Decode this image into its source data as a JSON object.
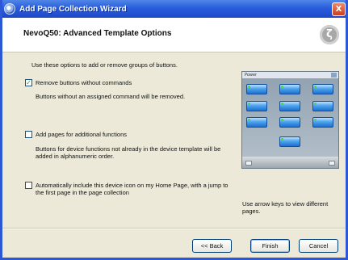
{
  "window": {
    "title": "Add Page Collection Wizard",
    "close_label": "X"
  },
  "header": {
    "heading": "NevoQ50: Advanced Template Options",
    "logo_glyph": "ζ"
  },
  "content": {
    "intro": "Use these options to add or remove groups of buttons.",
    "options": [
      {
        "label": "Remove buttons without commands",
        "checked": true,
        "description": "Buttons without an assigned command will be removed."
      },
      {
        "label": "Add pages for additional functions",
        "checked": false,
        "description": "Buttons for device functions not already in the device template will be added in alphanumeric order."
      },
      {
        "label": "Automatically include this device icon on my Home Page, with a jump to the first page in the page collection",
        "checked": false,
        "description": ""
      }
    ],
    "preview_title": "Power",
    "preview_hint": "Use arrow keys to view different pages."
  },
  "buttons": {
    "back": "<< Back",
    "finish": "Finish",
    "cancel": "Cancel"
  },
  "colors": {
    "titlebar": "#2a5ddd",
    "dialog_bg": "#ece9d8",
    "check_mark": "#21a121"
  }
}
